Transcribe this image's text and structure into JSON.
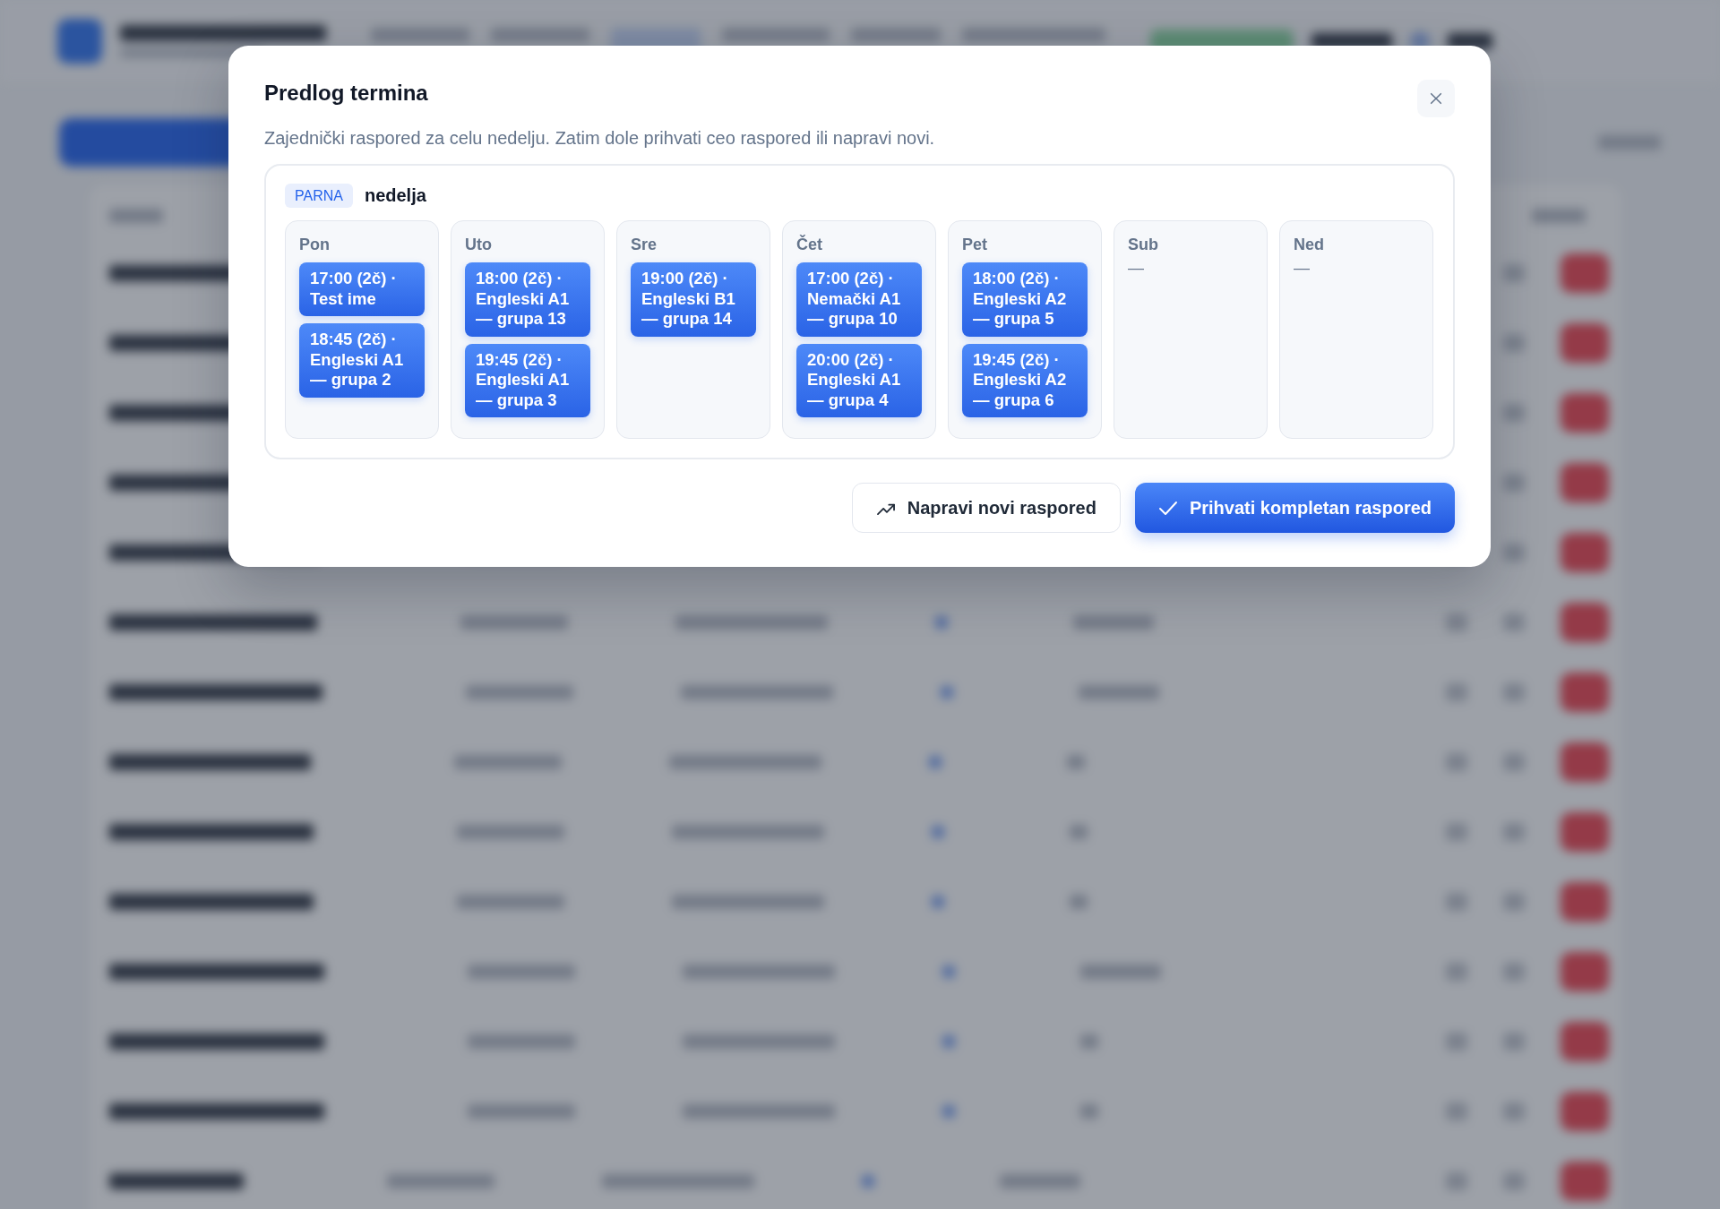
{
  "dialog": {
    "title": "Predlog termina",
    "description": "Zajednički raspored za celu nedelju. Zatim dole prihvati ceo raspored ili napravi novi.",
    "week": {
      "badge": "PARNA",
      "label": "nedelja",
      "days": [
        {
          "name": "Pon",
          "events": [
            {
              "label": "17:00 (2č) · Test ime"
            },
            {
              "label": "18:45 (2č) · Engleski A1 — grupa 2"
            }
          ]
        },
        {
          "name": "Uto",
          "events": [
            {
              "label": "18:00 (2č) · Engleski A1 — grupa 13"
            },
            {
              "label": "19:45 (2č) · Engleski A1 — grupa 3"
            }
          ]
        },
        {
          "name": "Sre",
          "events": [
            {
              "label": "19:00 (2č) · Engleski B1 — grupa 14"
            }
          ]
        },
        {
          "name": "Čet",
          "events": [
            {
              "label": "17:00 (2č) · Nemački A1 — grupa 10"
            },
            {
              "label": "20:00 (2č) · Engleski A1 — grupa 4"
            }
          ]
        },
        {
          "name": "Pet",
          "events": [
            {
              "label": "18:00 (2č) · Engleski A2 — grupa 5"
            },
            {
              "label": "19:45 (2č) · Engleski A2 — grupa 6"
            }
          ]
        },
        {
          "name": "Sub",
          "empty_marker": "—"
        },
        {
          "name": "Ned",
          "empty_marker": "—"
        }
      ]
    },
    "buttons": [
      {
        "label": "Napravi novi raspored",
        "kind": "secondary"
      },
      {
        "label": "Prihvati kompletan raspored",
        "kind": "primary"
      }
    ]
  }
}
